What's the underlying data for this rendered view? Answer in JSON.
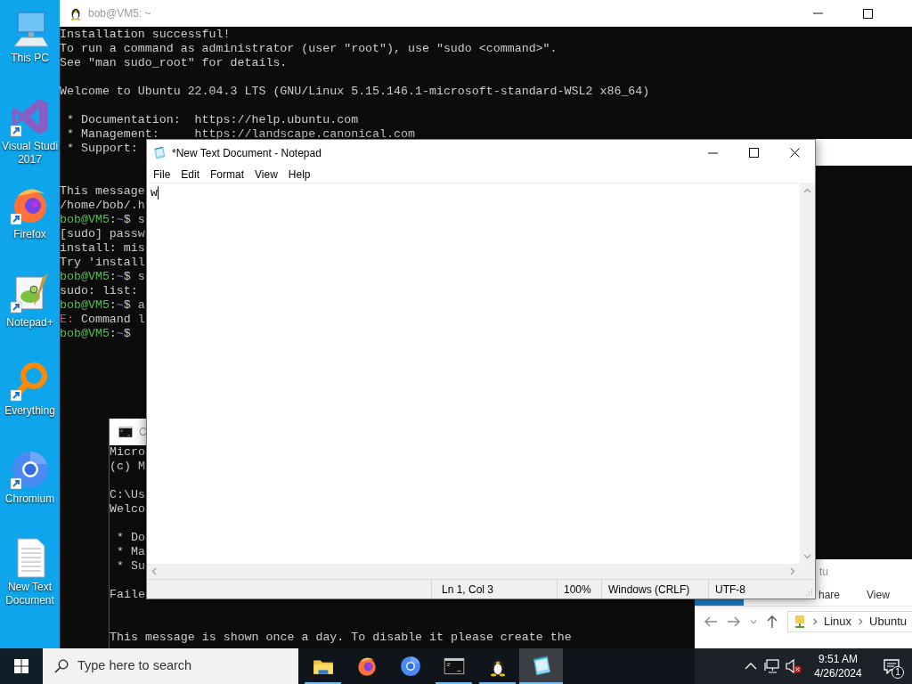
{
  "desktop_icons": [
    {
      "kind": "computer",
      "shortcut": false,
      "label": [
        "This PC"
      ]
    },
    {
      "kind": "visual-studio",
      "shortcut": true,
      "label": [
        "Visual Studi",
        "2017"
      ]
    },
    {
      "kind": "firefox",
      "shortcut": true,
      "label": [
        "Firefox"
      ]
    },
    {
      "kind": "notepadpp",
      "shortcut": true,
      "label": [
        "Notepad+"
      ]
    },
    {
      "kind": "everything",
      "shortcut": true,
      "label": [
        "Everything"
      ]
    },
    {
      "kind": "chromium",
      "shortcut": true,
      "label": [
        "Chromium"
      ]
    },
    {
      "kind": "text-file",
      "shortcut": false,
      "label": [
        "New Text",
        "Document"
      ]
    }
  ],
  "terminal": {
    "title": "bob@VM5: ~",
    "lines": [
      {
        "kind": "text",
        "text": "Installation successful!"
      },
      {
        "kind": "text",
        "text": "To run a command as administrator (user \"root\"), use \"sudo <command>\"."
      },
      {
        "kind": "text",
        "text": "See \"man sudo_root\" for details."
      },
      {
        "kind": "blank"
      },
      {
        "kind": "text",
        "text": "Welcome to Ubuntu 22.04.3 LTS (GNU/Linux 5.15.146.1-microsoft-standard-WSL2 x86_64)"
      },
      {
        "kind": "blank"
      },
      {
        "kind": "text",
        "text": " * Documentation:  https://help.ubuntu.com"
      },
      {
        "kind": "text",
        "text": " * Management:     https://landscape.canonical.com"
      },
      {
        "kind": "text",
        "text": " * Support:"
      },
      {
        "kind": "blank"
      },
      {
        "kind": "blank"
      },
      {
        "kind": "text",
        "text": "This message"
      },
      {
        "kind": "text",
        "text": "/home/bob/.h"
      },
      {
        "kind": "prompt",
        "host": "bob@VM5",
        "sep": ":",
        "path": "~",
        "rest": "$ s"
      },
      {
        "kind": "text",
        "text": "[sudo] passw"
      },
      {
        "kind": "text",
        "text": "install: mis"
      },
      {
        "kind": "text",
        "text": "Try 'install"
      },
      {
        "kind": "prompt",
        "host": "bob@VM5",
        "sep": ":",
        "path": "~",
        "rest": "$ s"
      },
      {
        "kind": "text",
        "text": "sudo: list:"
      },
      {
        "kind": "prompt",
        "host": "bob@VM5",
        "sep": ":",
        "path": "~",
        "rest": "$ a"
      },
      {
        "kind": "error",
        "tag": "E:",
        "text": " Command l"
      },
      {
        "kind": "prompt",
        "host": "bob@VM5",
        "sep": ":",
        "path": "~",
        "rest": "$"
      }
    ]
  },
  "cmd": {
    "title": "C",
    "lines": [
      {
        "kind": "text",
        "text": "Micro"
      },
      {
        "kind": "text",
        "text": "(c) M"
      },
      {
        "kind": "blank"
      },
      {
        "kind": "text",
        "text": "C:\\Us"
      },
      {
        "kind": "text",
        "text": "Welco"
      },
      {
        "kind": "blank"
      },
      {
        "kind": "text",
        "text": " * Do"
      },
      {
        "kind": "text",
        "text": " * Ma"
      },
      {
        "kind": "text",
        "text": " * Su"
      },
      {
        "kind": "blank"
      },
      {
        "kind": "text",
        "text": "Faile"
      },
      {
        "kind": "blank"
      },
      {
        "kind": "blank"
      },
      {
        "kind": "text",
        "text": "This message is shown once a day. To disable it please create the"
      }
    ]
  },
  "explorer": {
    "title": "tu",
    "ribbon": [
      "hare",
      "View"
    ],
    "address": [
      "Linux",
      "Ubuntu"
    ]
  },
  "notepad": {
    "title": "*New Text Document - Notepad",
    "menu": [
      "File",
      "Edit",
      "Format",
      "View",
      "Help"
    ],
    "content": "w",
    "status": {
      "position": "Ln 1, Col 3",
      "zoom": "100%",
      "line_ending": "Windows (CRLF)",
      "encoding": "UTF-8"
    }
  },
  "taskbar": {
    "search_placeholder": "Type here to search",
    "apps": [
      {
        "kind": "folder",
        "running": true,
        "selected": false
      },
      {
        "kind": "firefox",
        "running": false,
        "selected": false
      },
      {
        "kind": "chromium",
        "running": false,
        "selected": false
      },
      {
        "kind": "console",
        "running": true,
        "selected": false
      },
      {
        "kind": "penguin",
        "running": true,
        "selected": false
      },
      {
        "kind": "notepad",
        "running": true,
        "selected": true
      }
    ],
    "time": "9:51 AM",
    "date": "4/26/2024",
    "notification_count": "1"
  }
}
